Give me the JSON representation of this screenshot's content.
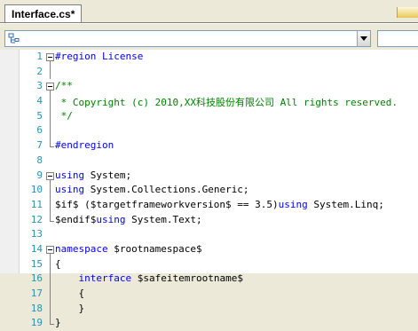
{
  "tab": {
    "title": "Interface.cs*"
  },
  "nav": {
    "types_value": "",
    "members_value": ""
  },
  "editor": {
    "lines": [
      {
        "num": "1",
        "fold": "open",
        "segments": [
          {
            "t": "#region License",
            "c": "kw"
          }
        ]
      },
      {
        "num": "2",
        "fold": "line",
        "segments": []
      },
      {
        "num": "3",
        "fold": "open",
        "segments": [
          {
            "t": "/**",
            "c": "cm"
          }
        ]
      },
      {
        "num": "4",
        "fold": "line",
        "segments": [
          {
            "t": " * Copyright (c) 2010,XX科技股份有限公司 All rights reserved.",
            "c": "cm"
          }
        ]
      },
      {
        "num": "5",
        "fold": "line",
        "segments": [
          {
            "t": " */",
            "c": "cm"
          }
        ]
      },
      {
        "num": "6",
        "fold": "line",
        "segments": []
      },
      {
        "num": "7",
        "fold": "end",
        "segments": [
          {
            "t": "#endregion",
            "c": "kw"
          }
        ]
      },
      {
        "num": "8",
        "fold": "none",
        "segments": []
      },
      {
        "num": "9",
        "fold": "open",
        "segments": [
          {
            "t": "using",
            "c": "kw"
          },
          {
            "t": " System;",
            "c": ""
          }
        ]
      },
      {
        "num": "10",
        "fold": "line",
        "segments": [
          {
            "t": "using",
            "c": "kw"
          },
          {
            "t": " System.Collections.Generic;",
            "c": ""
          }
        ]
      },
      {
        "num": "11",
        "fold": "line",
        "segments": [
          {
            "t": "$if$ ($targetframeworkversion$ == 3.5)",
            "c": ""
          },
          {
            "t": "using",
            "c": "kw"
          },
          {
            "t": " System.Linq;",
            "c": ""
          }
        ]
      },
      {
        "num": "12",
        "fold": "end",
        "segments": [
          {
            "t": "$endif$",
            "c": ""
          },
          {
            "t": "using",
            "c": "kw"
          },
          {
            "t": " System.Text;",
            "c": ""
          }
        ]
      },
      {
        "num": "13",
        "fold": "none",
        "segments": []
      },
      {
        "num": "14",
        "fold": "open",
        "segments": [
          {
            "t": "namespace",
            "c": "kw"
          },
          {
            "t": " $rootnamespace$",
            "c": ""
          }
        ]
      },
      {
        "num": "15",
        "fold": "line",
        "segments": [
          {
            "t": "{",
            "c": ""
          }
        ]
      },
      {
        "num": "16",
        "fold": "line",
        "segments": [
          {
            "t": "    ",
            "c": ""
          },
          {
            "t": "interface",
            "c": "kw"
          },
          {
            "t": " $safeitemrootname$",
            "c": ""
          }
        ]
      },
      {
        "num": "17",
        "fold": "line",
        "segments": [
          {
            "t": "    {",
            "c": ""
          }
        ]
      },
      {
        "num": "18",
        "fold": "line",
        "segments": [
          {
            "t": "    }",
            "c": ""
          }
        ]
      },
      {
        "num": "19",
        "fold": "end",
        "segments": [
          {
            "t": "}",
            "c": ""
          }
        ]
      }
    ]
  }
}
